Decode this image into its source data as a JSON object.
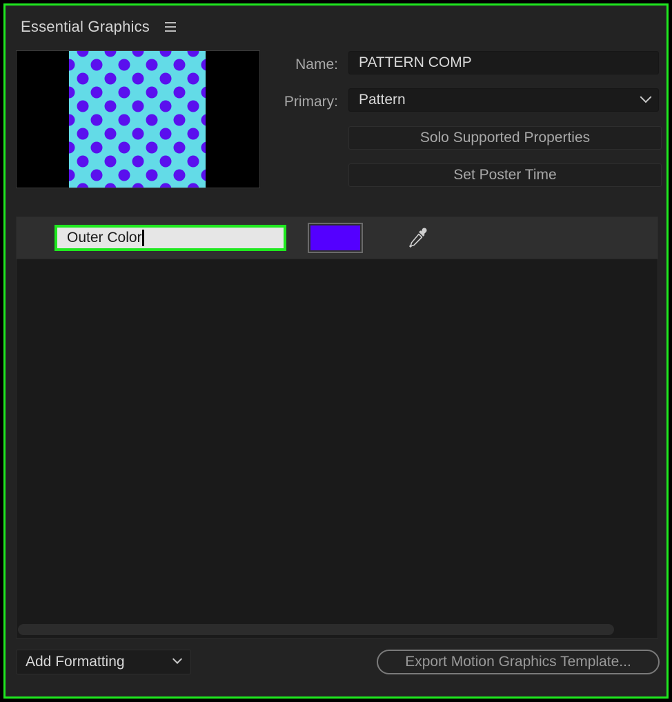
{
  "panel": {
    "title": "Essential Graphics",
    "border_color": "#1fe81f",
    "menu_icon": "hamburger-menu-icon"
  },
  "preview": {
    "background_color": "#63dbe7",
    "dot_color": "#5a10ee"
  },
  "fields": {
    "name_label": "Name:",
    "name_value": "PATTERN COMP",
    "primary_label": "Primary:",
    "primary_value": "Pattern",
    "primary_icon": "chevron-down-icon"
  },
  "buttons": {
    "solo_label": "Solo Supported Properties",
    "poster_label": "Set Poster Time"
  },
  "property": {
    "name_value": "Outer Color",
    "swatch_color": "#5400ff",
    "eyedropper_icon": "eyedropper-icon"
  },
  "footer": {
    "add_formatting_label": "Add Formatting",
    "export_label": "Export Motion Graphics Template..."
  }
}
